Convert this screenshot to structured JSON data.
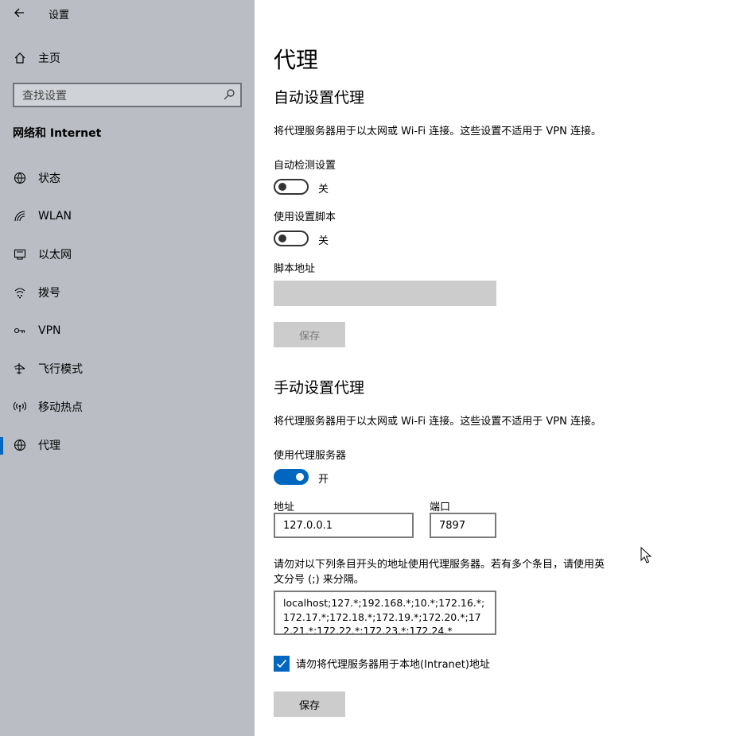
{
  "window": {
    "title": "设置"
  },
  "sidebar": {
    "home_label": "主页",
    "search_placeholder": "查找设置",
    "section_title": "网络和 Internet",
    "items": [
      {
        "label": "状态",
        "icon": "globe-status-icon"
      },
      {
        "label": "WLAN",
        "icon": "wifi-icon"
      },
      {
        "label": "以太网",
        "icon": "ethernet-icon"
      },
      {
        "label": "拨号",
        "icon": "dialup-icon"
      },
      {
        "label": "VPN",
        "icon": "vpn-icon"
      },
      {
        "label": "飞行模式",
        "icon": "airplane-icon"
      },
      {
        "label": "移动热点",
        "icon": "hotspot-icon"
      },
      {
        "label": "代理",
        "icon": "globe-icon",
        "active": true
      }
    ]
  },
  "main": {
    "page_title": "代理",
    "auto": {
      "heading": "自动设置代理",
      "description": "将代理服务器用于以太网或 Wi-Fi 连接。这些设置不适用于 VPN 连接。",
      "detect_label": "自动检测设置",
      "detect_state": "关",
      "script_label": "使用设置脚本",
      "script_state": "关",
      "address_label": "脚本地址",
      "save_label": "保存"
    },
    "manual": {
      "heading": "手动设置代理",
      "description": "将代理服务器用于以太网或 Wi-Fi 连接。这些设置不适用于 VPN 连接。",
      "use_proxy_label": "使用代理服务器",
      "use_proxy_state": "开",
      "address_label": "地址",
      "address_value": "127.0.0.1",
      "port_label": "端口",
      "port_value": "7897",
      "exceptions_note_line1": "请勿对以下列条目开头的地址使用代理服务器。若有多个条目，请使用英",
      "exceptions_note_line2": "文分号 (;) 来分隔。",
      "exceptions_value": "localhost;127.*;192.168.*;10.*;172.16.*;172.17.*;172.18.*;172.19.*;172.20.*;172.21.*;172.22.*;172.23.*;172.24.*",
      "bypass_local_label": "请勿将代理服务器用于本地(Intranet)地址",
      "bypass_local_checked": true,
      "save_label": "保存"
    }
  },
  "colors": {
    "accent": "#0067c0",
    "sidebar_bg": "#babec4"
  }
}
